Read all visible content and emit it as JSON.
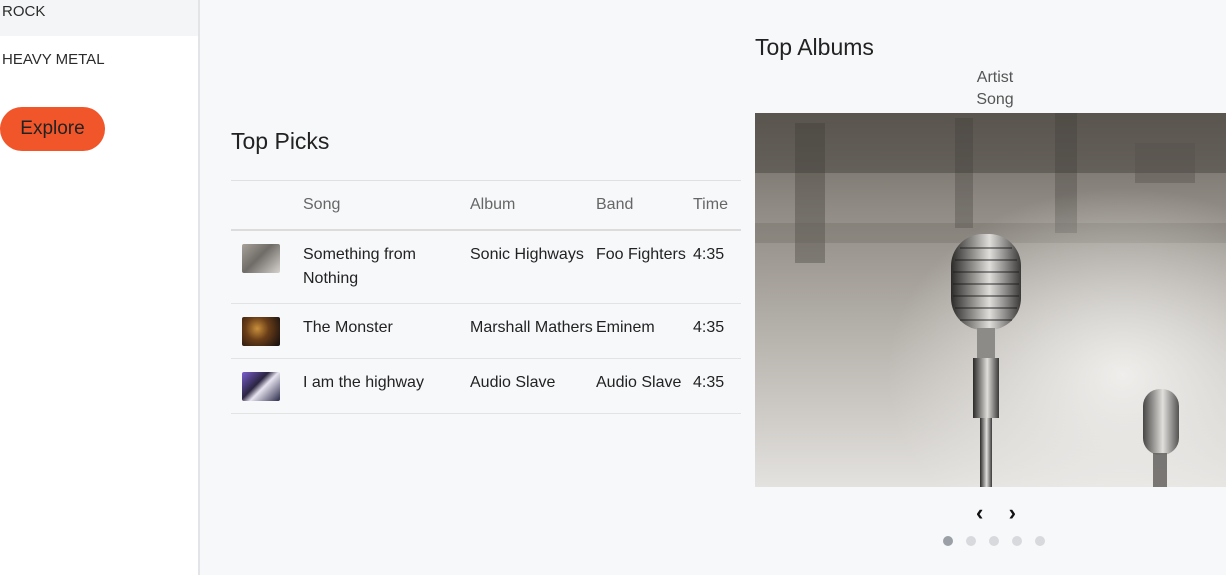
{
  "sidebar": {
    "genres": [
      {
        "label": "ROCK",
        "active": true
      },
      {
        "label": "HEAVY METAL",
        "active": false
      }
    ],
    "explore_label": "Explore",
    "accent_color": "#f1552a"
  },
  "top_picks": {
    "title": "Top Picks",
    "columns": [
      "",
      "Song",
      "Album",
      "Band",
      "Time"
    ],
    "rows": [
      {
        "thumb": "album-art-1",
        "song": "Something from Nothing",
        "album": "Sonic Highways",
        "band": "Foo Fighters",
        "time": "4:35"
      },
      {
        "thumb": "album-art-2",
        "song": "The Monster",
        "album": "Marshall Mathers",
        "band": "Eminem",
        "time": "4:35"
      },
      {
        "thumb": "album-art-3",
        "song": "I am the highway",
        "album": "Audio Slave",
        "band": "Audio Slave",
        "time": "4:35"
      }
    ]
  },
  "top_albums": {
    "title": "Top Albums",
    "artist": "Artist",
    "song": "Song",
    "image": "microphone-photo",
    "prev_icon": "chevron-left-icon",
    "next_icon": "chevron-right-icon",
    "slides": 5,
    "active_slide": 1
  }
}
